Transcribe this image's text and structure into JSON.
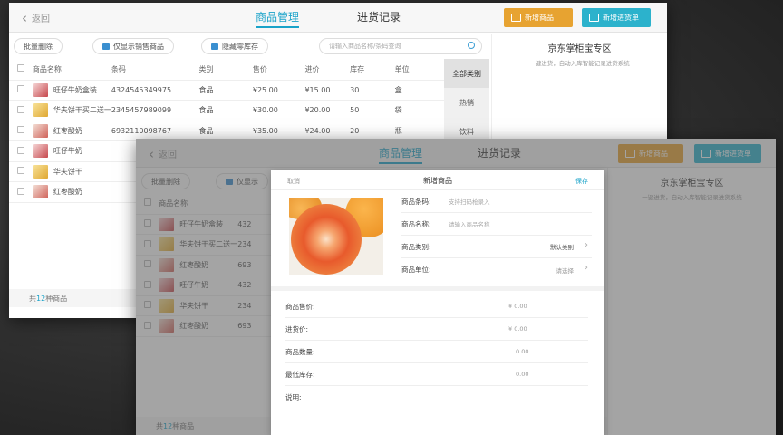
{
  "back_screen": {
    "back_label": "返回",
    "tab_goods": "商品管理",
    "tab_purchase": "进货记录",
    "btn_new_goods": "新增商品",
    "btn_new_purchase": "新增进货单",
    "toolbar": {
      "batch_delete": "批量删除",
      "only_saleable": "仅显示销售商品",
      "hide_zero_stock": "隐藏零库存",
      "search_placeholder": "请输入商品名称/条码查询"
    },
    "table": {
      "headers": [
        "商品名称",
        "条码",
        "类别",
        "售价",
        "进价",
        "库存",
        "单位"
      ],
      "rows": [
        [
          "旺仔牛奶盒装",
          "4324545349975",
          "食品",
          "¥25.00",
          "¥15.00",
          "30",
          "盒"
        ],
        [
          "华夫饼干买二送一",
          "2345457989099",
          "食品",
          "¥30.00",
          "¥20.00",
          "50",
          "袋"
        ],
        [
          "红枣酸奶",
          "6932110098767",
          "食品",
          "¥35.00",
          "¥24.00",
          "20",
          "瓶"
        ],
        [
          "旺仔牛奶",
          "",
          "",
          "",
          "",
          "",
          ""
        ],
        [
          "华夫饼干",
          "",
          "",
          "",
          "",
          "",
          ""
        ],
        [
          "红枣酸奶",
          "",
          "",
          "",
          "",
          "",
          ""
        ]
      ]
    },
    "categories": [
      "全部类别",
      "热销",
      "饮料"
    ],
    "right_title": "京东掌柜宝专区",
    "right_sub": "一键进货，自动入库智能记录进货系统",
    "footer_prefix": "共",
    "footer_count": "12",
    "footer_suffix": "种商品"
  },
  "front_screen": {
    "back_label": "返回",
    "tab_goods": "商品管理",
    "tab_purchase": "进货记录",
    "btn_new_goods": "新增商品",
    "btn_new_purchase": "新增进货单",
    "batch_delete": "批量删除",
    "only_saleable_partial": "仅显示",
    "col_name": "商品名称",
    "rows": [
      {
        "name": "旺仔牛奶盒装",
        "code": "432"
      },
      {
        "name": "华夫饼干买二送一",
        "code": "234"
      },
      {
        "name": "红枣酸奶",
        "code": "693"
      },
      {
        "name": "旺仔牛奶",
        "code": "432"
      },
      {
        "name": "华夫饼干",
        "code": "234"
      },
      {
        "name": "红枣酸奶",
        "code": "693"
      }
    ],
    "right_title": "京东掌柜宝专区",
    "right_sub": "一键进货，自动入库智能记录进货系统",
    "footer_prefix": "共",
    "footer_count": "12",
    "footer_suffix": "种商品"
  },
  "modal": {
    "cancel": "取消",
    "title": "新增商品",
    "save": "保存",
    "fields_top": [
      {
        "label": "商品条码:",
        "placeholder": "支持扫码枪录入",
        "value": ""
      },
      {
        "label": "商品名称:",
        "placeholder": "请输入商品名称",
        "value": ""
      },
      {
        "label": "商品类别:",
        "placeholder": "",
        "value": "默认类别"
      },
      {
        "label": "商品单位:",
        "placeholder": "",
        "value": "请选择"
      }
    ],
    "fields_bottom": [
      {
        "label": "商品售价:",
        "value": "¥ 0.00"
      },
      {
        "label": "进货价:",
        "value": "¥ 0.00"
      },
      {
        "label": "商品数量:",
        "value": "0.00"
      },
      {
        "label": "最低库存:",
        "value": "0.00"
      },
      {
        "label": "说明:",
        "value": ""
      }
    ]
  },
  "colors": {
    "accent": "#1aa3c9",
    "orange_button": "#e7a331",
    "teal_button": "#2cb2cc"
  }
}
